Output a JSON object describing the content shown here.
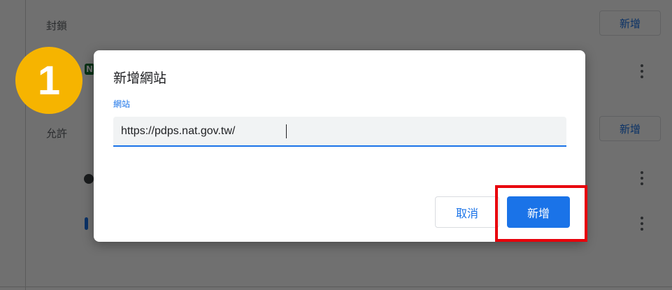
{
  "background": {
    "blocked_label": "封鎖",
    "allowed_label": "允許",
    "add_button_label": "新增",
    "site_initial": "N"
  },
  "step_badge": "1",
  "dialog": {
    "title": "新增網站",
    "field_label": "網站",
    "url_value": "https://pdps.nat.gov.tw/",
    "cancel_label": "取消",
    "add_label": "新增"
  },
  "colors": {
    "accent": "#1a73e8",
    "badge": "#f6b400",
    "highlight": "#e8000b"
  },
  "icons": [
    "more-vert-icon",
    "site-favicon-icon"
  ]
}
